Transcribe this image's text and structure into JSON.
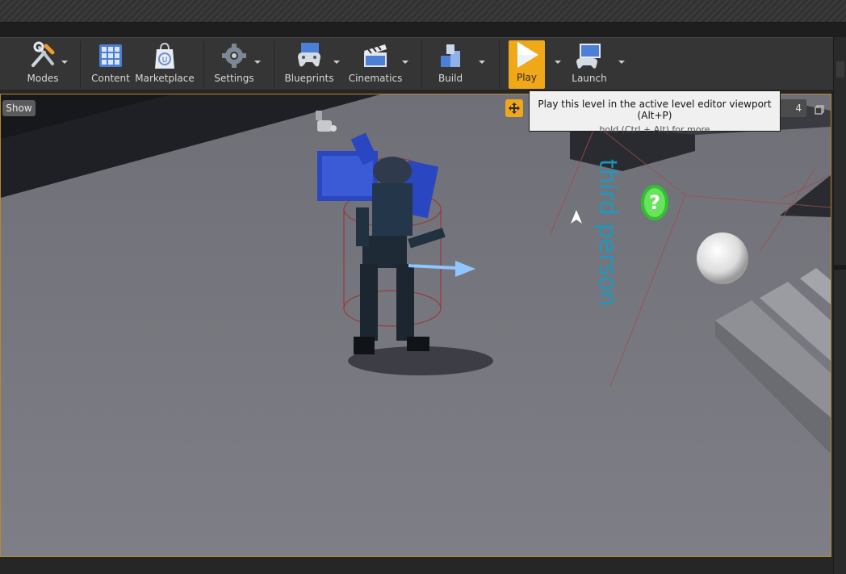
{
  "toolbar": {
    "modes_label": "Modes",
    "content_label": "Content",
    "marketplace_label": "Marketplace",
    "settings_label": "Settings",
    "blueprints_label": "Blueprints",
    "cinematics_label": "Cinematics",
    "build_label": "Build",
    "play_label": "Play",
    "launch_label": "Launch"
  },
  "viewport": {
    "show_label": "Show",
    "camera_speed": "4",
    "floor_text": "third person"
  },
  "tooltip": {
    "title": "Play this level in the active level editor viewport (Alt+P)",
    "hint": "hold (Ctrl + Alt) for more"
  },
  "colors": {
    "accent": "#f0a818",
    "floor_text": "#1aa6c8",
    "viewport_border": "#b58a2c"
  }
}
